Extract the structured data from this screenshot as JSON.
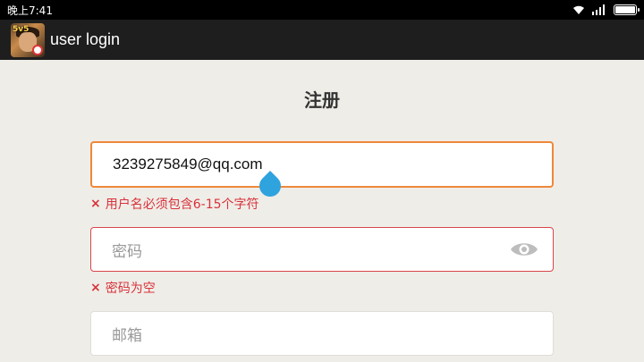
{
  "status_bar": {
    "time": "晚上7:41",
    "icons": [
      "wifi-icon",
      "signal-icon",
      "battery-icon"
    ]
  },
  "app_bar": {
    "title": "user login",
    "icon": "game-app-icon",
    "badge": "5v5"
  },
  "form": {
    "heading": "注册",
    "username": {
      "value": "3239275849@qq.com",
      "error": "用户名必须包含6-15个字符"
    },
    "password": {
      "placeholder": "密码",
      "error": "密码为空",
      "toggle_icon": "eye-icon"
    },
    "email": {
      "placeholder": "邮箱"
    }
  },
  "colors": {
    "accent_focus": "#f0883a",
    "error": "#d8323a",
    "cursor_handle": "#2fa3dd"
  },
  "error_mark": "×"
}
